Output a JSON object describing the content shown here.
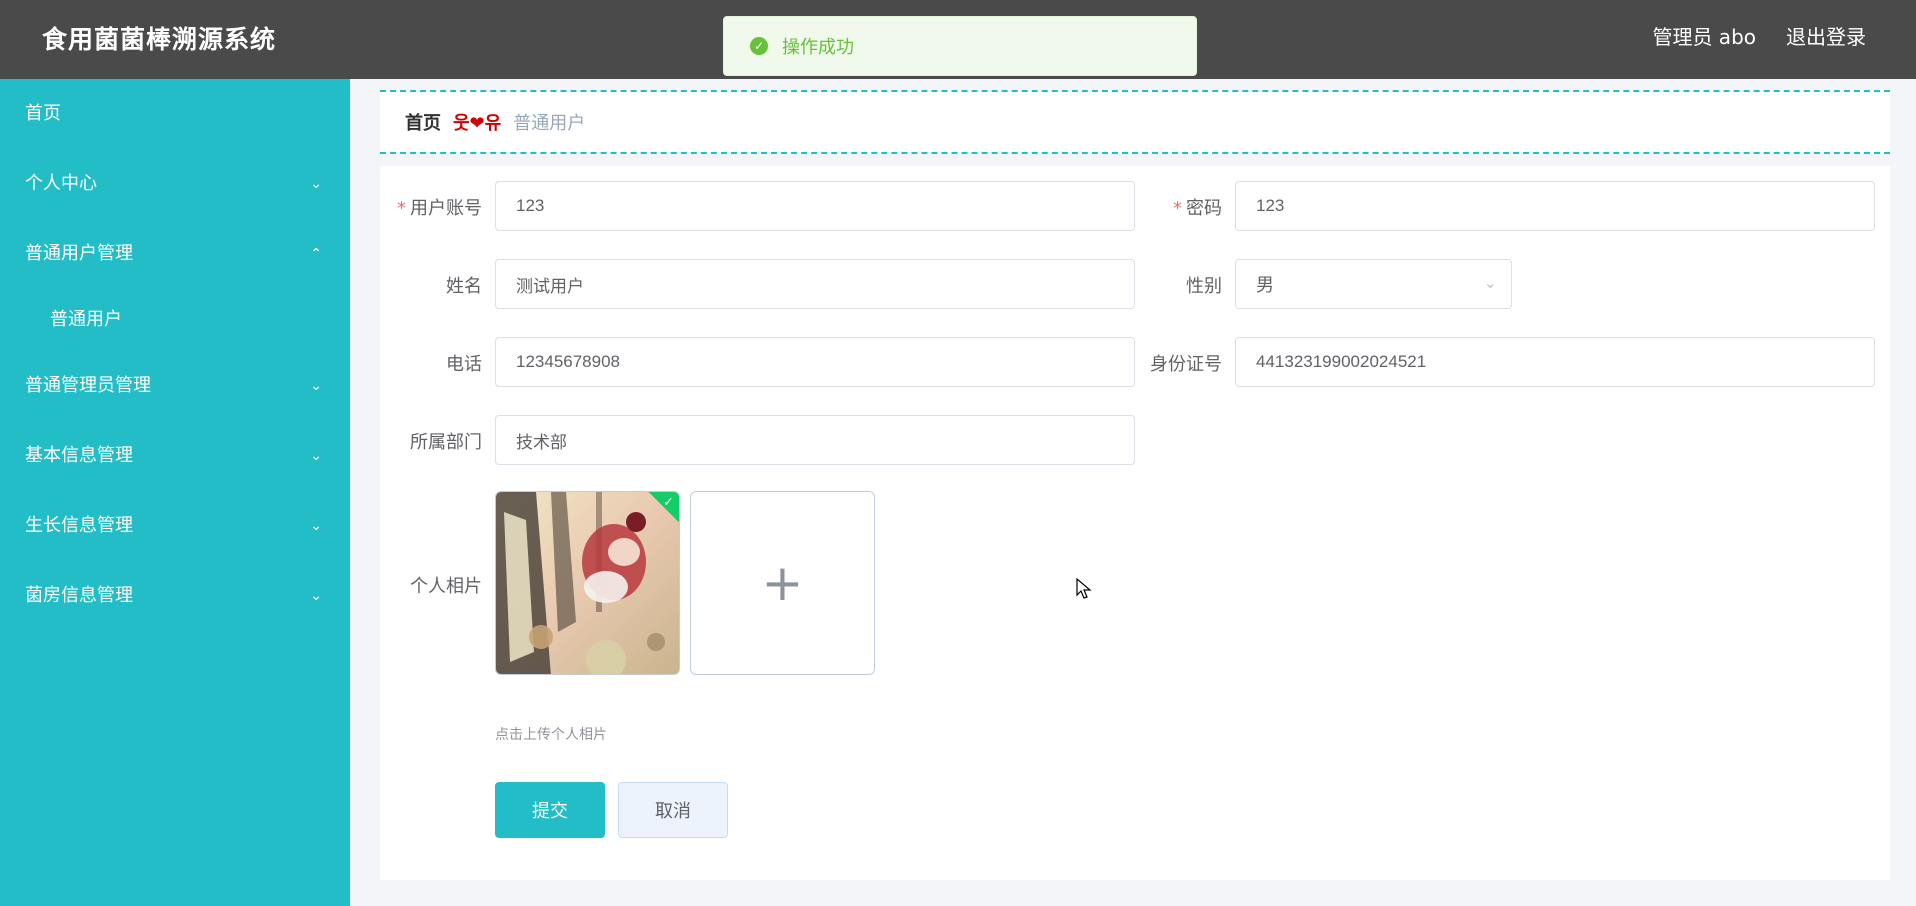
{
  "header": {
    "title": "食用菌菌棒溯源系统",
    "user": "管理员 abo",
    "logout": "退出登录"
  },
  "toast": {
    "message": "操作成功",
    "icon": "check-circle-icon"
  },
  "sidebar": {
    "items": [
      {
        "label": "首页"
      },
      {
        "label": "个人中心",
        "chevron": "⌄"
      },
      {
        "label": "普通用户管理",
        "chevron": "⌃"
      },
      {
        "label": "普通用户"
      },
      {
        "label": "普通管理员管理",
        "chevron": "⌄"
      },
      {
        "label": "基本信息管理",
        "chevron": "⌄"
      },
      {
        "label": "生长信息管理",
        "chevron": "⌄"
      },
      {
        "label": "菌房信息管理",
        "chevron": "⌄"
      }
    ]
  },
  "breadcrumb": {
    "home": "首页",
    "separator": "웃❤유",
    "current": "普通用户"
  },
  "form": {
    "account": {
      "label": "用户账号",
      "value": "123"
    },
    "password": {
      "label": "密码",
      "value": "123"
    },
    "name": {
      "label": "姓名",
      "value": "测试用户"
    },
    "gender": {
      "label": "性别",
      "value": "男"
    },
    "phone": {
      "label": "电话",
      "value": "12345678908"
    },
    "id_card": {
      "label": "身份证号",
      "value": "441323199002024521"
    },
    "department": {
      "label": "所属部门",
      "value": "技术部"
    },
    "photo": {
      "label": "个人相片",
      "tip": "点击上传个人相片"
    },
    "required_mark": "*"
  },
  "buttons": {
    "submit": "提交",
    "cancel": "取消"
  },
  "colors": {
    "accent": "#23bdc8",
    "header": "#4a4a4a",
    "success": "#67c23a"
  }
}
